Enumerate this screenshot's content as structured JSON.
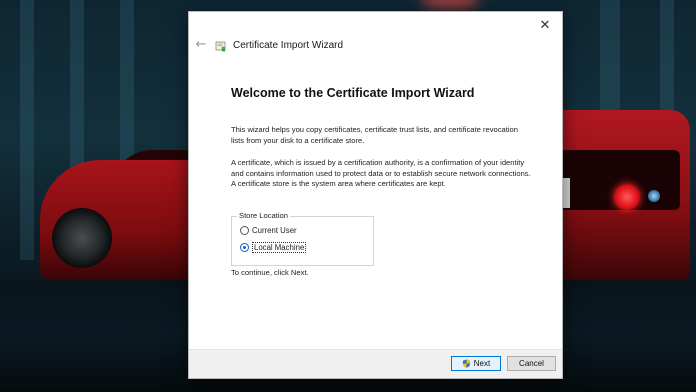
{
  "wizard": {
    "title": "Certificate Import Wizard",
    "close_glyph": "✕",
    "back_glyph": "←",
    "heading": "Welcome to the Certificate Import Wizard",
    "intro": "This wizard helps you copy certificates, certificate trust lists, and certificate revocation lists from your disk to a certificate store.",
    "description": "A certificate, which is issued by a certification authority, is a confirmation of your identity and contains information used to protect data or to establish secure network connections. A certificate store is the system area where certificates are kept.",
    "store_location": {
      "legend": "Store Location",
      "options": [
        {
          "label": "Current User",
          "selected": false
        },
        {
          "label": "Local Machine",
          "selected": true
        }
      ]
    },
    "continue_text": "To continue, click Next.",
    "buttons": {
      "next": "Next",
      "cancel": "Cancel"
    }
  },
  "colors": {
    "accent": "#0078d7",
    "radio_selected": "#1a5fb4",
    "footer_bg": "#f0f0f0"
  },
  "icons": [
    "close-icon",
    "back-arrow-icon",
    "certificate-icon",
    "uac-shield-icon"
  ]
}
